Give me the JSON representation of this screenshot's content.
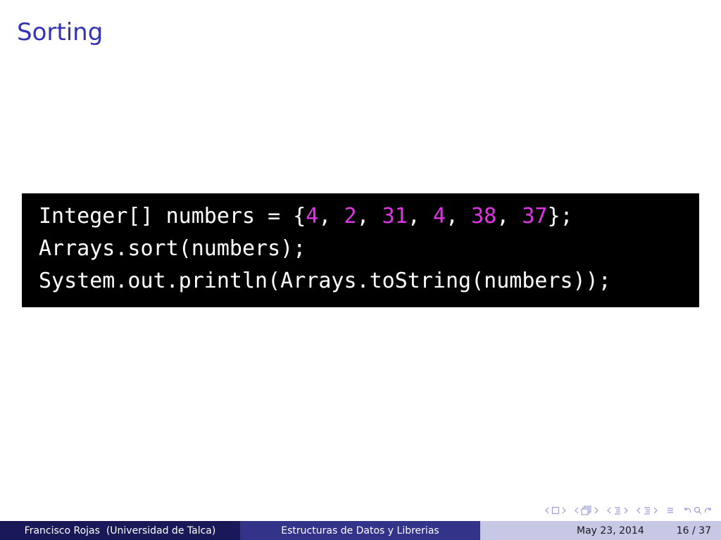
{
  "frame": {
    "title": "Sorting"
  },
  "code": {
    "lines": [
      {
        "parts": [
          {
            "text": "Integer[] numbers = {",
            "kind": "plain"
          },
          {
            "text": "4",
            "kind": "number"
          },
          {
            "text": ", ",
            "kind": "plain"
          },
          {
            "text": "2",
            "kind": "number"
          },
          {
            "text": ", ",
            "kind": "plain"
          },
          {
            "text": "31",
            "kind": "number"
          },
          {
            "text": ", ",
            "kind": "plain"
          },
          {
            "text": "4",
            "kind": "number"
          },
          {
            "text": ", ",
            "kind": "plain"
          },
          {
            "text": "38",
            "kind": "number"
          },
          {
            "text": ", ",
            "kind": "plain"
          },
          {
            "text": "37",
            "kind": "number"
          },
          {
            "text": "};",
            "kind": "plain"
          }
        ]
      },
      {
        "parts": [
          {
            "text": "Arrays.sort(numbers);",
            "kind": "plain"
          }
        ]
      },
      {
        "parts": [
          {
            "text": "System.out.println(Arrays.toString(numbers));",
            "kind": "plain"
          }
        ]
      }
    ]
  },
  "navigation": {
    "icons": [
      "prev-arrow-icon",
      "frame-icon",
      "next-arrow-icon",
      "prev-arrow-icon",
      "subsection-icon",
      "next-arrow-icon",
      "prev-arrow-icon",
      "section-icon",
      "next-arrow-icon",
      "prev-arrow-icon",
      "subsection-icon",
      "next-arrow-icon",
      "align-icon",
      "undo-icon",
      "search-icon",
      "redo-icon"
    ]
  },
  "footer": {
    "author": "Francisco Rojas  (Universidad de Talca)",
    "title": "Estructuras de Datos y Librerias",
    "date": "May 23, 2014",
    "page": "16 / 37"
  },
  "colors": {
    "title": "#3333b3",
    "code_background": "#000000",
    "code_text": "#ffffff",
    "code_number": "#e033e6",
    "footer_dark": "#191959",
    "footer_mid": "#33338a",
    "footer_light": "#c7c7e6",
    "nav_icons": "#9b9bd6"
  }
}
